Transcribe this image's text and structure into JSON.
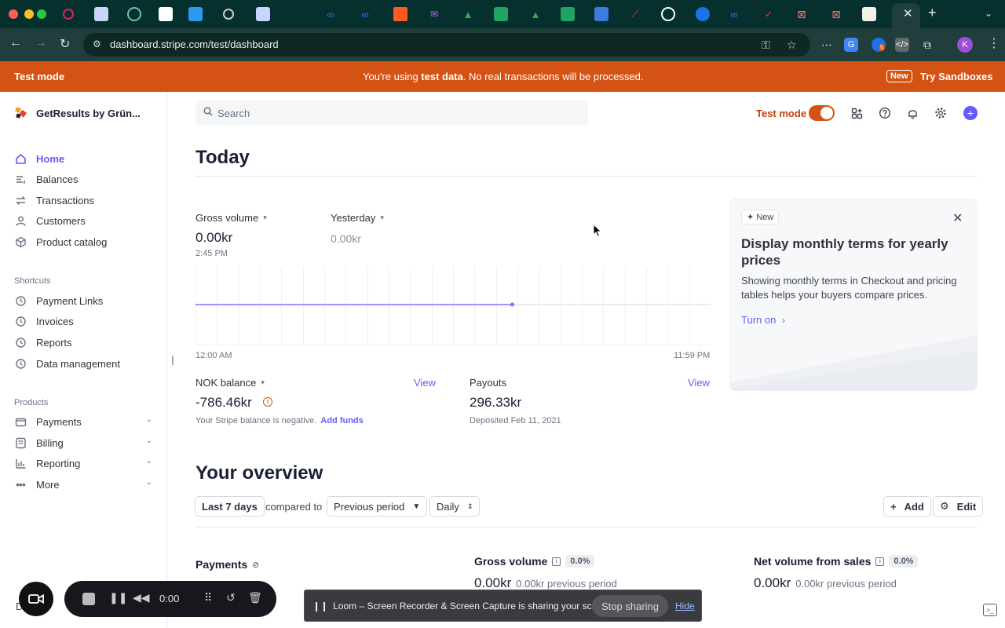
{
  "browser": {
    "url": "dashboard.stripe.com/test/dashboard",
    "profile_initial": "K",
    "extension_badge": "5"
  },
  "banner": {
    "left": "Test mode",
    "center_prefix": "You're using ",
    "center_bold": "test data",
    "center_suffix": ". No real transactions will be processed.",
    "new_badge": "New",
    "cta": "Try Sandboxes"
  },
  "sidebar": {
    "brand": "GetResults by Grün...",
    "items": [
      {
        "label": "Home",
        "icon": "home-icon"
      },
      {
        "label": "Balances",
        "icon": "balances-icon"
      },
      {
        "label": "Transactions",
        "icon": "transactions-icon"
      },
      {
        "label": "Customers",
        "icon": "customers-icon"
      },
      {
        "label": "Product catalog",
        "icon": "box-icon"
      }
    ],
    "shortcuts_label": "Shortcuts",
    "shortcuts": [
      {
        "label": "Payment Links",
        "icon": "clock-icon"
      },
      {
        "label": "Invoices",
        "icon": "clock-icon"
      },
      {
        "label": "Reports",
        "icon": "clock-icon"
      },
      {
        "label": "Data management",
        "icon": "clock-icon"
      }
    ],
    "products_label": "Products",
    "products": [
      {
        "label": "Payments",
        "icon": "wallet-icon"
      },
      {
        "label": "Billing",
        "icon": "billing-icon"
      },
      {
        "label": "Reporting",
        "icon": "bar-chart-icon"
      },
      {
        "label": "More",
        "icon": "more-icon"
      }
    ],
    "developers_peek": "Develo"
  },
  "header": {
    "search_placeholder": "Search",
    "test_mode_label": "Test mode"
  },
  "today": {
    "title": "Today",
    "gross_volume_label": "Gross volume",
    "gross_volume_value": "0.00kr",
    "gross_volume_time": "2:45 PM",
    "yesterday_label": "Yesterday",
    "yesterday_value": "0.00kr",
    "chart_start": "12:00 AM",
    "chart_end": "11:59 PM",
    "balance_label": "NOK balance",
    "balance_view": "View",
    "balance_value": "-786.46kr",
    "balance_note": "Your Stripe balance is negative.",
    "add_funds": "Add funds",
    "payouts_label": "Payouts",
    "payouts_view": "View",
    "payouts_value": "296.33kr",
    "payouts_note": "Deposited Feb 11, 2021"
  },
  "chart_data": {
    "type": "line",
    "title": "",
    "x_start": "12:00 AM",
    "x_end": "11:59 PM",
    "now_fraction": 0.615,
    "values": [
      0,
      0
    ],
    "color": "#7a73ff"
  },
  "promo": {
    "badge": "New",
    "title": "Display monthly terms for yearly prices",
    "body": "Showing monthly terms in Checkout and pricing tables helps your buyers compare prices.",
    "link": "Turn on"
  },
  "overview": {
    "title": "Your overview",
    "range": "Last 7 days",
    "compared_to": "compared to",
    "comparison": "Previous period",
    "interval": "Daily",
    "add": "Add",
    "edit": "Edit",
    "payments_title": "Payments",
    "gross_volume_title": "Gross volume",
    "gross_volume_pct": "0.0%",
    "gross_volume_value": "0.00kr",
    "gross_volume_prev": "0.00kr previous period",
    "net_volume_title": "Net volume from sales",
    "net_volume_pct": "0.0%",
    "net_volume_value": "0.00kr",
    "net_volume_prev": "0.00kr previous period"
  },
  "loom": {
    "time": "0:00",
    "share_text": "Loom – Screen Recorder & Screen Capture is sharing your screen.",
    "stop": "Stop sharing",
    "hide": "Hide"
  },
  "colors": {
    "accent": "#635bff",
    "test_mode": "#d45314",
    "chrome_dark": "#06302e"
  }
}
